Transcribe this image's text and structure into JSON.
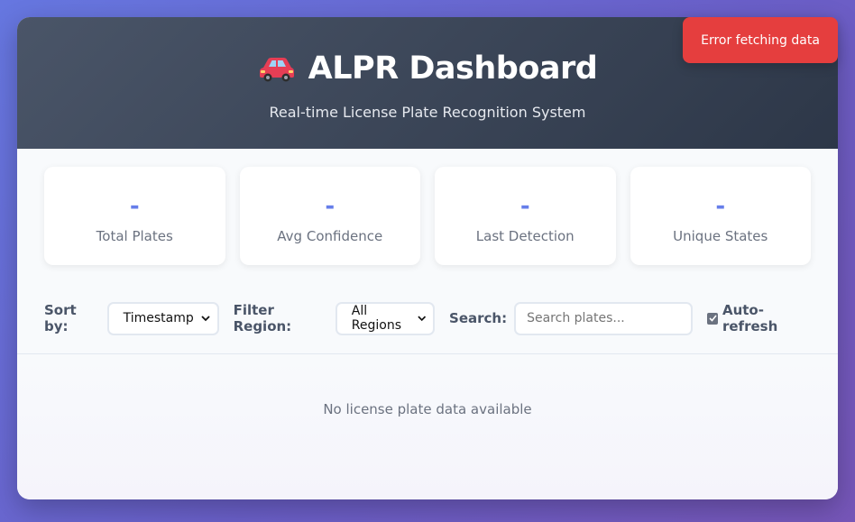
{
  "header": {
    "icon": "car-icon",
    "title": "ALPR Dashboard",
    "subtitle": "Real-time License Plate Recognition System"
  },
  "stats": [
    {
      "value": "-",
      "label": "Total Plates"
    },
    {
      "value": "-",
      "label": "Avg Confidence"
    },
    {
      "value": "-",
      "label": "Last Detection"
    },
    {
      "value": "-",
      "label": "Unique States"
    }
  ],
  "controls": {
    "sort_label": "Sort by:",
    "sort_value": "Timestamp",
    "region_label": "Filter Region:",
    "region_value": "All Regions",
    "search_label": "Search:",
    "search_placeholder": "Search plates...",
    "search_value": "",
    "auto_refresh_label": "Auto-refresh",
    "auto_refresh_checked": true
  },
  "empty_message": "No license plate data available",
  "toast": {
    "message": "Error fetching data",
    "color": "#e53e3e"
  },
  "colors": {
    "accent": "#667eea",
    "header_bg": "#2d3748"
  }
}
